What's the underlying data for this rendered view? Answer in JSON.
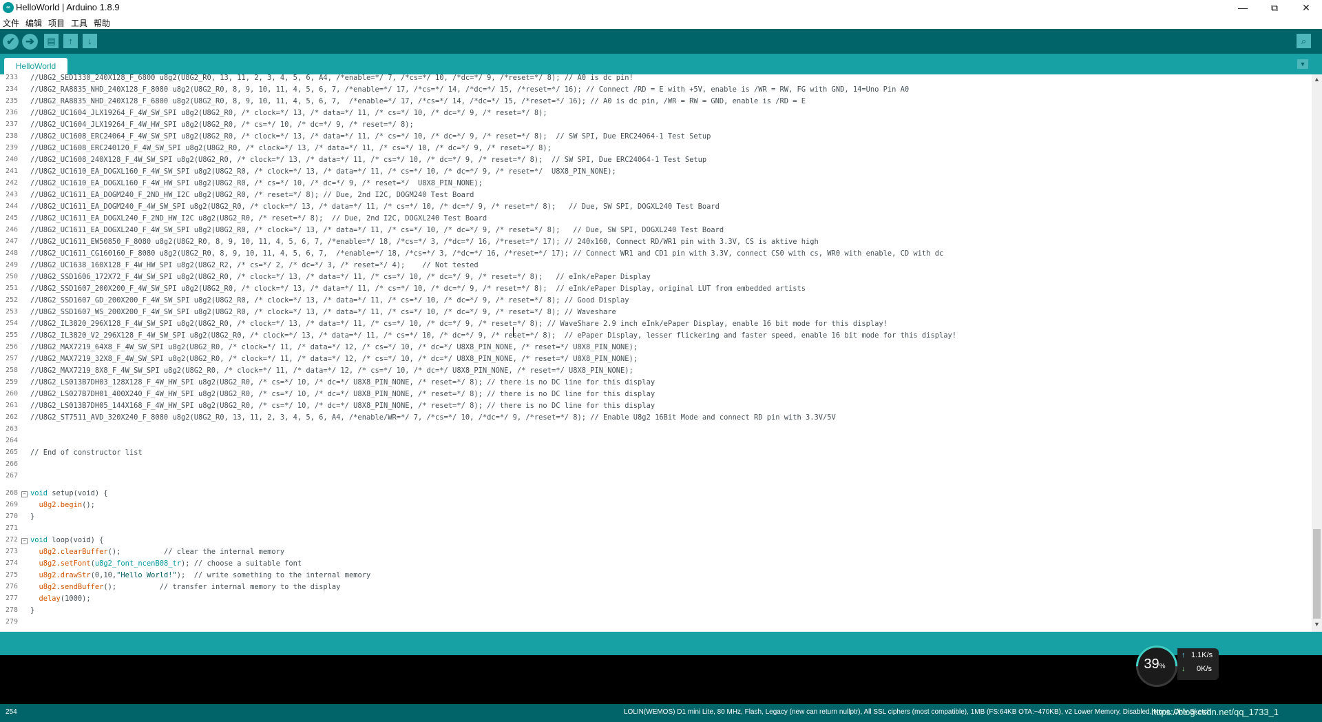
{
  "window": {
    "title": "HelloWorld | Arduino 1.8.9",
    "logo": "∞",
    "minimize": "—",
    "maximize": "⧉",
    "close": "✕"
  },
  "menu": [
    "文件",
    "编辑",
    "项目",
    "工具",
    "帮助"
  ],
  "toolbar": {
    "verify_icon": "✔",
    "upload_icon": "➔",
    "new_icon": "▤",
    "open_icon": "↑",
    "save_icon": "↓",
    "serial_monitor_icon": "⌕"
  },
  "tab": {
    "label": "HelloWorld",
    "menu_icon": "▼"
  },
  "editor": {
    "lines": [
      {
        "n": "233",
        "text": "//U8G2_SED1330_240X128_F_6800 u8g2(U8G2_R0, 13, 11, 2, 3, 4, 5, 6, A4, /*enable=*/ 7, /*cs=*/ 10, /*dc=*/ 9, /*reset=*/ 8); // A0 is dc pin!"
      },
      {
        "n": "234",
        "text": "//U8G2_RA8835_NHD_240X128_F_8080 u8g2(U8G2_R0, 8, 9, 10, 11, 4, 5, 6, 7, /*enable=*/ 17, /*cs=*/ 14, /*dc=*/ 15, /*reset=*/ 16); // Connect /RD = E with +5V, enable is /WR = RW, FG with GND, 14=Uno Pin A0"
      },
      {
        "n": "235",
        "text": "//U8G2_RA8835_NHD_240X128_F_6800 u8g2(U8G2_R0, 8, 9, 10, 11, 4, 5, 6, 7,  /*enable=*/ 17, /*cs=*/ 14, /*dc=*/ 15, /*reset=*/ 16); // A0 is dc pin, /WR = RW = GND, enable is /RD = E"
      },
      {
        "n": "236",
        "text": "//U8G2_UC1604_JLX19264_F_4W_SW_SPI u8g2(U8G2_R0, /* clock=*/ 13, /* data=*/ 11, /* cs=*/ 10, /* dc=*/ 9, /* reset=*/ 8);"
      },
      {
        "n": "237",
        "text": "//U8G2_UC1604_JLX19264_F_4W_HW_SPI u8g2(U8G2_R0, /* cs=*/ 10, /* dc=*/ 9, /* reset=*/ 8);"
      },
      {
        "n": "238",
        "text": "//U8G2_UC1608_ERC24064_F_4W_SW_SPI u8g2(U8G2_R0, /* clock=*/ 13, /* data=*/ 11, /* cs=*/ 10, /* dc=*/ 9, /* reset=*/ 8);  // SW SPI, Due ERC24064-1 Test Setup"
      },
      {
        "n": "239",
        "text": "//U8G2_UC1608_ERC240120_F_4W_SW_SPI u8g2(U8G2_R0, /* clock=*/ 13, /* data=*/ 11, /* cs=*/ 10, /* dc=*/ 9, /* reset=*/ 8);"
      },
      {
        "n": "240",
        "text": "//U8G2_UC1608_240X128_F_4W_SW_SPI u8g2(U8G2_R0, /* clock=*/ 13, /* data=*/ 11, /* cs=*/ 10, /* dc=*/ 9, /* reset=*/ 8);  // SW SPI, Due ERC24064-1 Test Setup"
      },
      {
        "n": "241",
        "text": "//U8G2_UC1610_EA_DOGXL160_F_4W_SW_SPI u8g2(U8G2_R0, /* clock=*/ 13, /* data=*/ 11, /* cs=*/ 10, /* dc=*/ 9, /* reset=*/  U8X8_PIN_NONE);"
      },
      {
        "n": "242",
        "text": "//U8G2_UC1610_EA_DOGXL160_F_4W_HW_SPI u8g2(U8G2_R0, /* cs=*/ 10, /* dc=*/ 9, /* reset=*/  U8X8_PIN_NONE);"
      },
      {
        "n": "243",
        "text": "//U8G2_UC1611_EA_DOGM240_F_2ND_HW_I2C u8g2(U8G2_R0, /* reset=*/ 8); // Due, 2nd I2C, DOGM240 Test Board"
      },
      {
        "n": "244",
        "text": "//U8G2_UC1611_EA_DOGM240_F_4W_SW_SPI u8g2(U8G2_R0, /* clock=*/ 13, /* data=*/ 11, /* cs=*/ 10, /* dc=*/ 9, /* reset=*/ 8);   // Due, SW SPI, DOGXL240 Test Board"
      },
      {
        "n": "245",
        "text": "//U8G2_UC1611_EA_DOGXL240_F_2ND_HW_I2C u8g2(U8G2_R0, /* reset=*/ 8);  // Due, 2nd I2C, DOGXL240 Test Board"
      },
      {
        "n": "246",
        "text": "//U8G2_UC1611_EA_DOGXL240_F_4W_SW_SPI u8g2(U8G2_R0, /* clock=*/ 13, /* data=*/ 11, /* cs=*/ 10, /* dc=*/ 9, /* reset=*/ 8);   // Due, SW SPI, DOGXL240 Test Board"
      },
      {
        "n": "247",
        "text": "//U8G2_UC1611_EW50850_F_8080 u8g2(U8G2_R0, 8, 9, 10, 11, 4, 5, 6, 7, /*enable=*/ 18, /*cs=*/ 3, /*dc=*/ 16, /*reset=*/ 17); // 240x160, Connect RD/WR1 pin with 3.3V, CS is aktive high"
      },
      {
        "n": "248",
        "text": "//U8G2_UC1611_CG160160_F_8080 u8g2(U8G2_R0, 8, 9, 10, 11, 4, 5, 6, 7,  /*enable=*/ 18, /*cs=*/ 3, /*dc=*/ 16, /*reset=*/ 17); // Connect WR1 and CD1 pin with 3.3V, connect CS0 with cs, WR0 with enable, CD with dc"
      },
      {
        "n": "249",
        "text": "//U8G2_UC1638_160X128_F_4W_HW_SPI u8g2(U8G2_R2, /* cs=*/ 2, /* dc=*/ 3, /* reset=*/ 4);    // Not tested"
      },
      {
        "n": "250",
        "text": "//U8G2_SSD1606_172X72_F_4W_SW_SPI u8g2(U8G2_R0, /* clock=*/ 13, /* data=*/ 11, /* cs=*/ 10, /* dc=*/ 9, /* reset=*/ 8);   // eInk/ePaper Display"
      },
      {
        "n": "251",
        "text": "//U8G2_SSD1607_200X200_F_4W_SW_SPI u8g2(U8G2_R0, /* clock=*/ 13, /* data=*/ 11, /* cs=*/ 10, /* dc=*/ 9, /* reset=*/ 8);  // eInk/ePaper Display, original LUT from embedded artists"
      },
      {
        "n": "252",
        "text": "//U8G2_SSD1607_GD_200X200_F_4W_SW_SPI u8g2(U8G2_R0, /* clock=*/ 13, /* data=*/ 11, /* cs=*/ 10, /* dc=*/ 9, /* reset=*/ 8); // Good Display"
      },
      {
        "n": "253",
        "text": "//U8G2_SSD1607_WS_200X200_F_4W_SW_SPI u8g2(U8G2_R0, /* clock=*/ 13, /* data=*/ 11, /* cs=*/ 10, /* dc=*/ 9, /* reset=*/ 8); // Waveshare"
      },
      {
        "n": "254",
        "text": "//U8G2_IL3820_296X128_F_4W_SW_SPI u8g2(U8G2_R0, /* clock=*/ 13, /* data=*/ 11, /* cs=*/ 10, /* dc=*/ 9, /* reset=*/ 8); // WaveShare 2.9 inch eInk/ePaper Display, enable 16 bit mode for this display!"
      },
      {
        "n": "255",
        "text": "//U8G2_IL3820_V2_296X128_F_4W_SW_SPI u8g2(U8G2_R0, /* clock=*/ 13, /* data=*/ 11, /* cs=*/ 10, /* dc=*/ 9, /* reset=*/ 8);  // ePaper Display, lesser flickering and faster speed, enable 16 bit mode for this display!"
      },
      {
        "n": "256",
        "text": "//U8G2_MAX7219_64X8_F_4W_SW_SPI u8g2(U8G2_R0, /* clock=*/ 11, /* data=*/ 12, /* cs=*/ 10, /* dc=*/ U8X8_PIN_NONE, /* reset=*/ U8X8_PIN_NONE);"
      },
      {
        "n": "257",
        "text": "//U8G2_MAX7219_32X8_F_4W_SW_SPI u8g2(U8G2_R0, /* clock=*/ 11, /* data=*/ 12, /* cs=*/ 10, /* dc=*/ U8X8_PIN_NONE, /* reset=*/ U8X8_PIN_NONE);"
      },
      {
        "n": "258",
        "text": "//U8G2_MAX7219_8X8_F_4W_SW_SPI u8g2(U8G2_R0, /* clock=*/ 11, /* data=*/ 12, /* cs=*/ 10, /* dc=*/ U8X8_PIN_NONE, /* reset=*/ U8X8_PIN_NONE);"
      },
      {
        "n": "259",
        "text": "//U8G2_LS013B7DH03_128X128_F_4W_HW_SPI u8g2(U8G2_R0, /* cs=*/ 10, /* dc=*/ U8X8_PIN_NONE, /* reset=*/ 8); // there is no DC line for this display"
      },
      {
        "n": "260",
        "text": "//U8G2_LS027B7DH01_400X240_F_4W_HW_SPI u8g2(U8G2_R0, /* cs=*/ 10, /* dc=*/ U8X8_PIN_NONE, /* reset=*/ 8); // there is no DC line for this display"
      },
      {
        "n": "261",
        "text": "//U8G2_LS013B7DH05_144X168_F_4W_HW_SPI u8g2(U8G2_R0, /* cs=*/ 10, /* dc=*/ U8X8_PIN_NONE, /* reset=*/ 8); // there is no DC line for this display"
      },
      {
        "n": "262",
        "text": "//U8G2_ST7511_AVD_320X240_F_8080 u8g2(U8G2_R0, 13, 11, 2, 3, 4, 5, 6, A4, /*enable/WR=*/ 7, /*cs=*/ 10, /*dc=*/ 9, /*reset=*/ 8); // Enable U8g2 16Bit Mode and connect RD pin with 3.3V/5V"
      },
      {
        "n": "263",
        "text": ""
      },
      {
        "n": "264",
        "text": ""
      },
      {
        "n": "265",
        "text": "// End of constructor list"
      },
      {
        "n": "266",
        "text": ""
      },
      {
        "n": "267",
        "text": ""
      }
    ],
    "setup": {
      "n268": "268",
      "n269": "269",
      "n270": "270",
      "n271": "271",
      "fold": "−",
      "kw_void": "void",
      "fn_setup": "setup",
      "void_sig": "(void) {",
      "begin_obj": "u8g2",
      "begin_fn": ".begin",
      "begin_rest": "();",
      "close": "}"
    },
    "loop": {
      "n272": "272",
      "n273": "273",
      "n274": "274",
      "n275": "275",
      "n276": "276",
      "n277": "277",
      "n278": "278",
      "n279": "279",
      "fold": "−",
      "kw_void": "void",
      "fn_loop": "loop",
      "void_sig": "(void) {",
      "l273_obj": "u8g2",
      "l273_fn": ".clearBuffer",
      "l273_rest": "();          // clear the internal memory",
      "l274_obj": "u8g2",
      "l274_fn": ".setFont",
      "l274_open": "(",
      "l274_arg": "u8g2_font_ncenB08_tr",
      "l274_rest": "); // choose a suitable font",
      "l275_obj": "u8g2",
      "l275_fn": ".drawStr",
      "l275_args": "(0,10,",
      "l275_str": "\"Hello World!\"",
      "l275_rest": ");  // write something to the internal memory",
      "l276_obj": "u8g2",
      "l276_fn": ".sendBuffer",
      "l276_rest": "();          // transfer internal memory to the display",
      "l277_fn": "delay",
      "l277_rest": "(1000);",
      "close": "}"
    }
  },
  "scrollbar": {
    "up": "▲",
    "down": "▼"
  },
  "footer": {
    "line_number": "254",
    "board": "LOLIN(WEMOS) D1 mini Lite, 80 MHz, Flash, Legacy (new can return nullptr), All SSL ciphers (most compatible), 1MB (FS:64KB OTA:~470KB), v2 Lower Memory, Disabled, None, Only Sketch",
    "watermark": "https://blog.csdn.net/qq_1733_1"
  },
  "net_monitor": {
    "percent": "39",
    "percent_unit": "%",
    "up_icon": "↑",
    "up_rate": "1.1K/s",
    "down_icon": "↓",
    "down_rate": "0K/s"
  },
  "colors": {
    "toolbar": "#006468",
    "tabbar": "#17a1a5",
    "keyword": "#00979c",
    "function": "#d35400"
  }
}
